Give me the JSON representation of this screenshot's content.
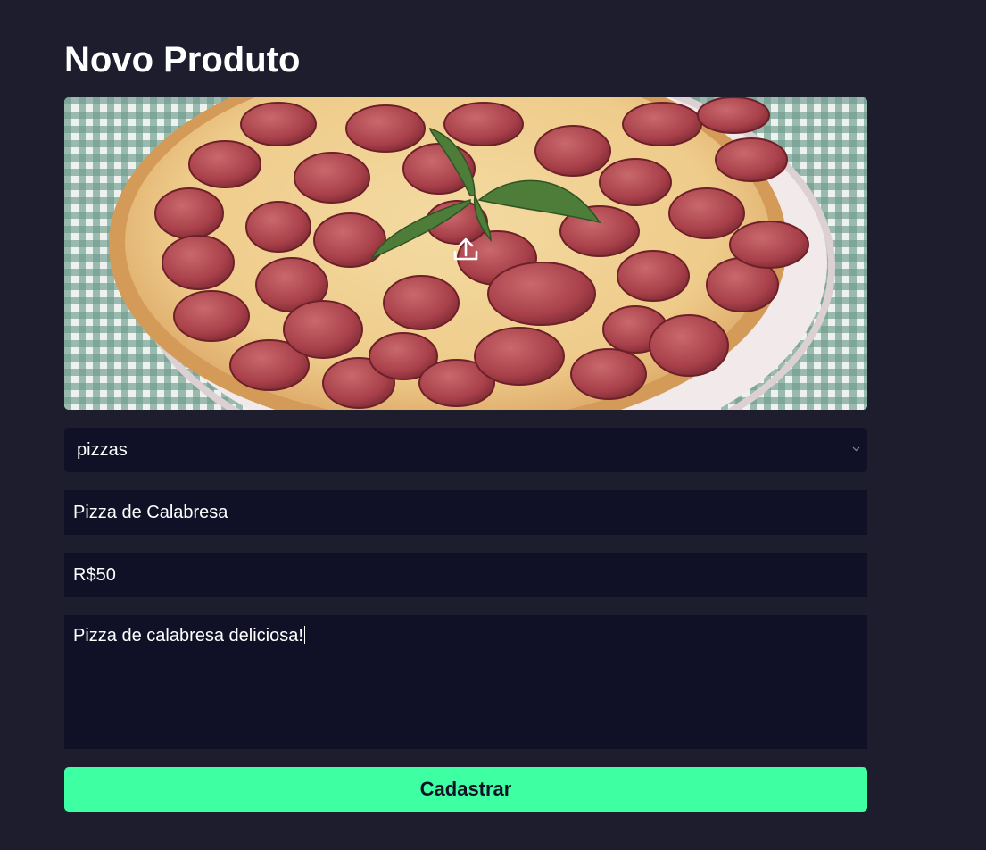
{
  "page": {
    "title": "Novo Produto"
  },
  "image_upload": {
    "icon": "upload-icon"
  },
  "form": {
    "category_selected": "pizzas",
    "name_value": "Pizza de Calabresa",
    "price_value": "R$50",
    "description_value": "Pizza de calabresa deliciosa!",
    "submit_label": "Cadastrar"
  },
  "colors": {
    "background": "#1d1d2e",
    "input_background": "#101026",
    "accent": "#3fffa3",
    "text": "#ffffff"
  }
}
